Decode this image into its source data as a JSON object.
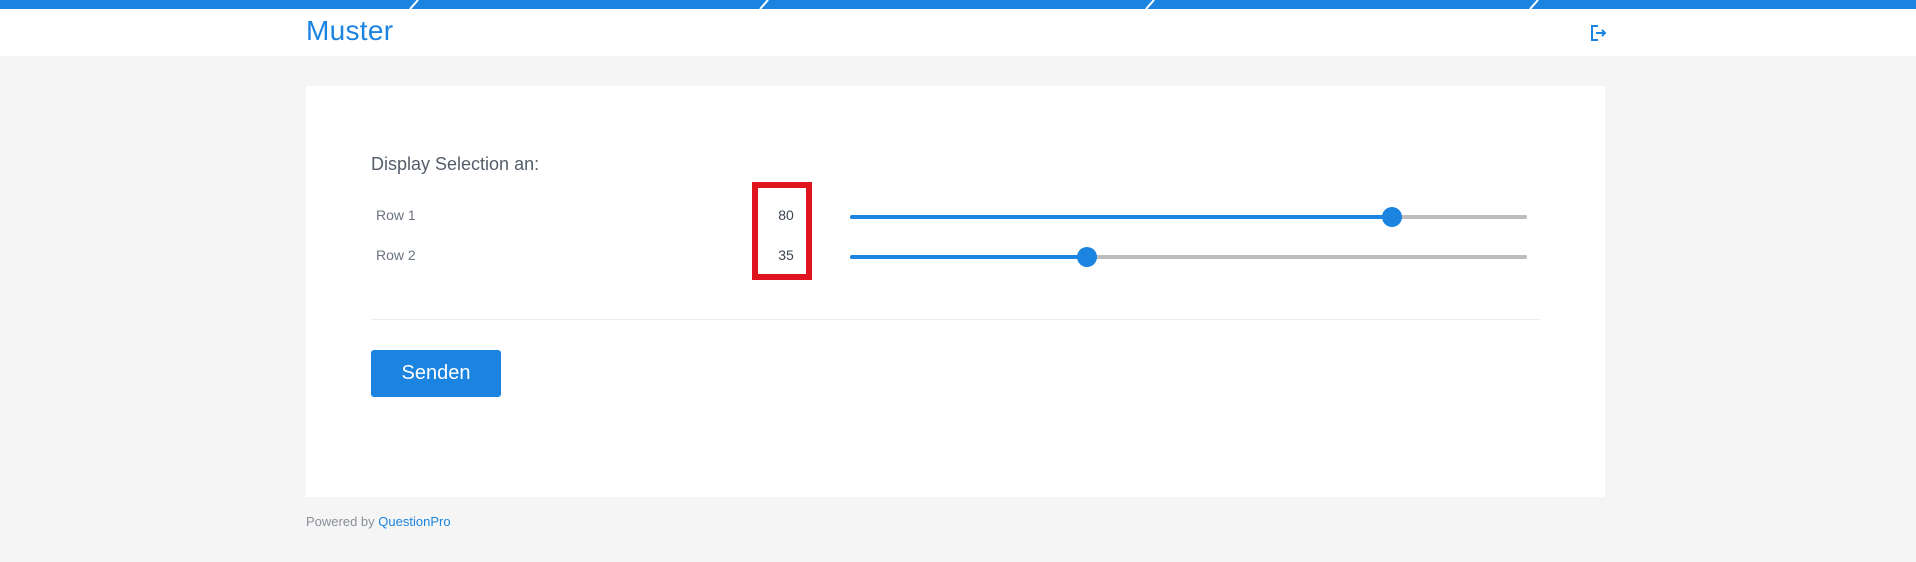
{
  "header": {
    "title": "Muster",
    "logout_icon": "logout-icon"
  },
  "question": {
    "title": "Display Selection an:",
    "rows": [
      {
        "label": "Row 1",
        "value": "80",
        "level_percent": 80
      },
      {
        "label": "Row 2",
        "value": "35",
        "level_percent": 35
      }
    ]
  },
  "form": {
    "submit_label": "Senden"
  },
  "footer": {
    "powered_by": "Powered by",
    "brand": "QuestionPro"
  },
  "colors": {
    "accent": "#1a84e0",
    "highlight": "#e0141e",
    "track": "#bdbdbd"
  }
}
